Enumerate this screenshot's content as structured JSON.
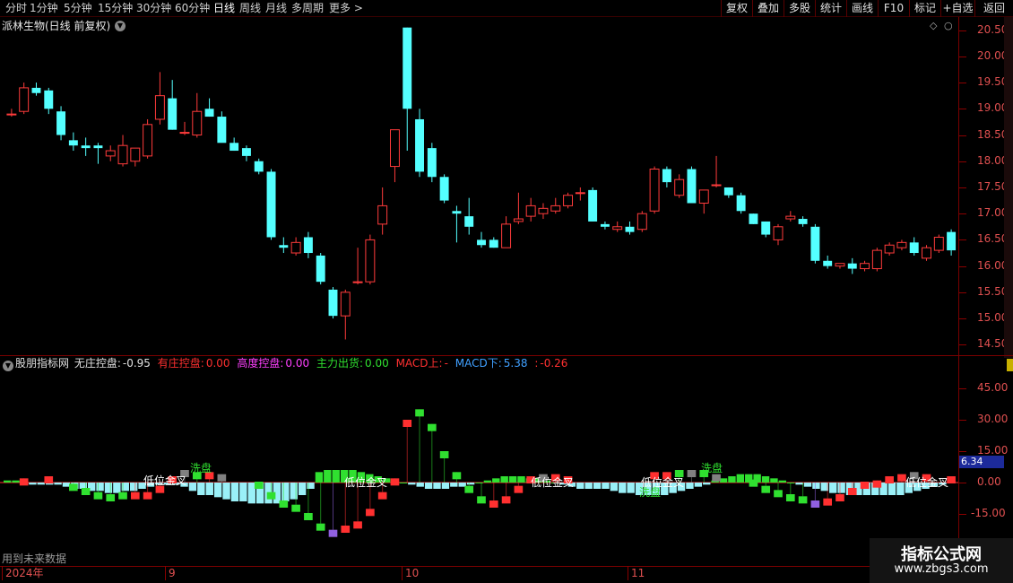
{
  "toolbar": {
    "periods": [
      "分时",
      "1分钟",
      "5分钟",
      "15分钟",
      "30分钟",
      "60分钟",
      "日线",
      "周线",
      "月线",
      "多周期",
      "更多"
    ],
    "more_arrow": ">",
    "active_period": "日线",
    "buttons": [
      "复权",
      "叠加",
      "多股",
      "统计",
      "画线",
      "F10",
      "标记",
      "+自选",
      "返回"
    ]
  },
  "main_chart": {
    "title": "派林生物(日线 前复权)",
    "y_ticks": [
      "20.50",
      "20.00",
      "19.50",
      "19.00",
      "18.50",
      "18.00",
      "17.50",
      "17.00",
      "16.50",
      "16.00",
      "15.50",
      "15.00",
      "14.50"
    ]
  },
  "indicator": {
    "name": "股朋指标网",
    "items": [
      {
        "label": "无庄控盘:",
        "value": "-0.95",
        "color": "#e0e0e0"
      },
      {
        "label": "有庄控盘:",
        "value": "0.00",
        "color": "#ff3030"
      },
      {
        "label": "高度控盘:",
        "value": "0.00",
        "color": "#ff40ff"
      },
      {
        "label": "主力出货:",
        "value": "0.00",
        "color": "#30e030"
      },
      {
        "label": "MACD上:",
        "value": "-",
        "color": "#ff3030"
      },
      {
        "label": "MACD下:",
        "value": "5.38",
        "color": "#40a0ff"
      },
      {
        "label": ":",
        "value": "-0.26",
        "color": "#ff3030"
      }
    ],
    "y_ticks": [
      "45.00",
      "30.00",
      "15.00",
      "0.00",
      "-15.00"
    ],
    "current_value": "6.34",
    "annotations": [
      "低位金叉",
      "洗盘",
      "低位金叉",
      "低位金叉",
      "低位金叉",
      "洗盘",
      "洗盘",
      "低位金叉"
    ],
    "future_note": "用到未来数据"
  },
  "dates": {
    "labels": [
      "2024年",
      "9",
      "10",
      "11"
    ]
  },
  "watermark": {
    "title": "指标公式网",
    "url": "www.zbgs3.com"
  },
  "chart_data": {
    "type": "candlestick",
    "ylim": [
      14.3,
      20.75
    ],
    "candles": [
      {
        "o": 18.9,
        "h": 19.0,
        "l": 18.85,
        "c": 18.9
      },
      {
        "o": 18.95,
        "h": 19.5,
        "l": 18.9,
        "c": 19.4
      },
      {
        "o": 19.4,
        "h": 19.5,
        "l": 19.25,
        "c": 19.3
      },
      {
        "o": 19.35,
        "h": 19.4,
        "l": 18.9,
        "c": 19.0
      },
      {
        "o": 18.95,
        "h": 19.05,
        "l": 18.4,
        "c": 18.5
      },
      {
        "o": 18.4,
        "h": 18.55,
        "l": 18.2,
        "c": 18.3
      },
      {
        "o": 18.3,
        "h": 18.45,
        "l": 18.1,
        "c": 18.25
      },
      {
        "o": 18.3,
        "h": 18.35,
        "l": 17.95,
        "c": 18.25
      },
      {
        "o": 18.1,
        "h": 18.3,
        "l": 18.0,
        "c": 18.2
      },
      {
        "o": 17.95,
        "h": 18.5,
        "l": 17.9,
        "c": 18.3
      },
      {
        "o": 18.0,
        "h": 18.25,
        "l": 17.9,
        "c": 18.25
      },
      {
        "o": 18.1,
        "h": 18.8,
        "l": 18.05,
        "c": 18.7
      },
      {
        "o": 18.8,
        "h": 19.7,
        "l": 18.7,
        "c": 19.25
      },
      {
        "o": 19.2,
        "h": 19.55,
        "l": 18.6,
        "c": 18.6
      },
      {
        "o": 18.55,
        "h": 18.75,
        "l": 18.5,
        "c": 18.55
      },
      {
        "o": 18.5,
        "h": 19.3,
        "l": 18.45,
        "c": 18.95
      },
      {
        "o": 19.0,
        "h": 19.2,
        "l": 18.85,
        "c": 18.85
      },
      {
        "o": 18.85,
        "h": 18.95,
        "l": 18.4,
        "c": 18.35
      },
      {
        "o": 18.35,
        "h": 18.45,
        "l": 18.2,
        "c": 18.2
      },
      {
        "o": 18.25,
        "h": 18.3,
        "l": 18.0,
        "c": 18.1
      },
      {
        "o": 18.0,
        "h": 18.05,
        "l": 17.75,
        "c": 17.8
      },
      {
        "o": 17.8,
        "h": 17.85,
        "l": 16.5,
        "c": 16.55
      },
      {
        "o": 16.4,
        "h": 16.55,
        "l": 16.25,
        "c": 16.35
      },
      {
        "o": 16.25,
        "h": 16.55,
        "l": 16.2,
        "c": 16.45
      },
      {
        "o": 16.55,
        "h": 16.65,
        "l": 16.15,
        "c": 16.25
      },
      {
        "o": 16.2,
        "h": 16.25,
        "l": 15.65,
        "c": 15.7
      },
      {
        "o": 15.55,
        "h": 15.6,
        "l": 15.0,
        "c": 15.05
      },
      {
        "o": 15.05,
        "h": 15.55,
        "l": 14.6,
        "c": 15.5
      },
      {
        "o": 15.7,
        "h": 16.35,
        "l": 15.65,
        "c": 15.7
      },
      {
        "o": 15.7,
        "h": 16.6,
        "l": 15.65,
        "c": 16.5
      },
      {
        "o": 16.8,
        "h": 17.5,
        "l": 16.6,
        "c": 17.15
      },
      {
        "o": 17.9,
        "h": 18.6,
        "l": 17.6,
        "c": 18.6
      },
      {
        "o": 20.55,
        "h": 20.55,
        "l": 18.2,
        "c": 19.0
      },
      {
        "o": 18.8,
        "h": 19.0,
        "l": 17.7,
        "c": 17.8
      },
      {
        "o": 18.25,
        "h": 18.35,
        "l": 17.6,
        "c": 17.7
      },
      {
        "o": 17.7,
        "h": 17.75,
        "l": 17.2,
        "c": 17.25
      },
      {
        "o": 17.05,
        "h": 17.15,
        "l": 16.45,
        "c": 17.0
      },
      {
        "o": 16.95,
        "h": 17.3,
        "l": 16.6,
        "c": 16.75
      },
      {
        "o": 16.5,
        "h": 16.65,
        "l": 16.35,
        "c": 16.4
      },
      {
        "o": 16.5,
        "h": 16.55,
        "l": 16.35,
        "c": 16.35
      },
      {
        "o": 16.35,
        "h": 16.95,
        "l": 16.35,
        "c": 16.8
      },
      {
        "o": 16.85,
        "h": 17.4,
        "l": 16.8,
        "c": 16.9
      },
      {
        "o": 16.95,
        "h": 17.3,
        "l": 16.85,
        "c": 17.15
      },
      {
        "o": 17.0,
        "h": 17.2,
        "l": 16.9,
        "c": 17.1
      },
      {
        "o": 17.05,
        "h": 17.3,
        "l": 17.0,
        "c": 17.15
      },
      {
        "o": 17.15,
        "h": 17.4,
        "l": 17.1,
        "c": 17.35
      },
      {
        "o": 17.4,
        "h": 17.5,
        "l": 17.25,
        "c": 17.4
      },
      {
        "o": 17.45,
        "h": 17.5,
        "l": 16.85,
        "c": 16.85
      },
      {
        "o": 16.8,
        "h": 16.85,
        "l": 16.7,
        "c": 16.75
      },
      {
        "o": 16.7,
        "h": 16.85,
        "l": 16.65,
        "c": 16.75
      },
      {
        "o": 16.75,
        "h": 16.85,
        "l": 16.6,
        "c": 16.65
      },
      {
        "o": 16.7,
        "h": 17.05,
        "l": 16.65,
        "c": 17.0
      },
      {
        "o": 17.05,
        "h": 17.9,
        "l": 17.0,
        "c": 17.85
      },
      {
        "o": 17.85,
        "h": 17.9,
        "l": 17.5,
        "c": 17.6
      },
      {
        "o": 17.35,
        "h": 17.75,
        "l": 17.3,
        "c": 17.65
      },
      {
        "o": 17.85,
        "h": 17.9,
        "l": 17.2,
        "c": 17.2
      },
      {
        "o": 17.2,
        "h": 17.45,
        "l": 17.0,
        "c": 17.45
      },
      {
        "o": 17.55,
        "h": 18.1,
        "l": 17.5,
        "c": 17.55
      },
      {
        "o": 17.5,
        "h": 17.5,
        "l": 17.3,
        "c": 17.35
      },
      {
        "o": 17.35,
        "h": 17.4,
        "l": 17.0,
        "c": 17.05
      },
      {
        "o": 17.0,
        "h": 17.0,
        "l": 16.8,
        "c": 16.8
      },
      {
        "o": 16.85,
        "h": 16.85,
        "l": 16.55,
        "c": 16.6
      },
      {
        "o": 16.5,
        "h": 16.8,
        "l": 16.4,
        "c": 16.75
      },
      {
        "o": 16.9,
        "h": 17.05,
        "l": 16.85,
        "c": 16.95
      },
      {
        "o": 16.9,
        "h": 16.95,
        "l": 16.75,
        "c": 16.8
      },
      {
        "o": 16.75,
        "h": 16.8,
        "l": 16.05,
        "c": 16.1
      },
      {
        "o": 16.1,
        "h": 16.2,
        "l": 15.95,
        "c": 16.0
      },
      {
        "o": 16.0,
        "h": 16.05,
        "l": 15.95,
        "c": 16.05
      },
      {
        "o": 16.05,
        "h": 16.15,
        "l": 15.85,
        "c": 15.95
      },
      {
        "o": 15.95,
        "h": 16.1,
        "l": 15.9,
        "c": 16.05
      },
      {
        "o": 15.95,
        "h": 16.35,
        "l": 15.9,
        "c": 16.3
      },
      {
        "o": 16.25,
        "h": 16.45,
        "l": 16.2,
        "c": 16.4
      },
      {
        "o": 16.35,
        "h": 16.5,
        "l": 16.3,
        "c": 16.45
      },
      {
        "o": 16.45,
        "h": 16.55,
        "l": 16.2,
        "c": 16.25
      },
      {
        "o": 16.15,
        "h": 16.4,
        "l": 16.1,
        "c": 16.35
      },
      {
        "o": 16.3,
        "h": 16.6,
        "l": 16.25,
        "c": 16.55
      },
      {
        "o": 16.65,
        "h": 16.7,
        "l": 16.2,
        "c": 16.3
      }
    ],
    "histogram": [
      1,
      1,
      0,
      -1,
      -1,
      -1,
      -1,
      -2,
      -3,
      -3,
      -4,
      -4,
      -5,
      -5,
      -4,
      -4,
      -3,
      -2,
      -1,
      -1,
      -1,
      -2,
      -4,
      -6,
      -6,
      -7,
      -8,
      -9,
      -9,
      -10,
      -10,
      -10,
      -10,
      -9,
      -8,
      -6,
      -3,
      5,
      6,
      6,
      6,
      6,
      5,
      4,
      3,
      2,
      1,
      0,
      -1,
      -2,
      -3,
      -3,
      -3,
      -2,
      -2,
      -1,
      0,
      1,
      2,
      3,
      3,
      3,
      2,
      2,
      1,
      0,
      -1,
      -2,
      -3,
      -3,
      -3,
      -3,
      -4,
      -5,
      -5,
      -6,
      -6,
      -6,
      -6,
      -5,
      -4,
      -3,
      -2,
      -1,
      1,
      2,
      3,
      4,
      4,
      4,
      3,
      2,
      1,
      0,
      -1,
      -2,
      -3,
      -4,
      -5,
      -5,
      -6,
      -6,
      -6,
      -6,
      -6,
      -6,
      -6,
      -5,
      -4,
      -3,
      -2,
      -1,
      1
    ],
    "markers": [
      {
        "i": 1,
        "v": 2,
        "c": "#ff3030"
      },
      {
        "i": 3,
        "v": 3,
        "c": "#ff3030"
      },
      {
        "i": 5,
        "v": -4,
        "c": "#30e030"
      },
      {
        "i": 6,
        "v": -6,
        "c": "#30e030"
      },
      {
        "i": 7,
        "v": -8,
        "c": "#30e030"
      },
      {
        "i": 8,
        "v": -9,
        "c": "#30e030"
      },
      {
        "i": 9,
        "v": -8,
        "c": "#30e030"
      },
      {
        "i": 10,
        "v": -8,
        "c": "#ff3030"
      },
      {
        "i": 11,
        "v": -8,
        "c": "#ff3030"
      },
      {
        "i": 12,
        "v": -5,
        "c": "#ff3030"
      },
      {
        "i": 13,
        "v": 3,
        "c": "#ff3030"
      },
      {
        "i": 14,
        "v": 6,
        "c": "#808080"
      },
      {
        "i": 15,
        "v": 5,
        "c": "#30e030"
      },
      {
        "i": 16,
        "v": 5,
        "c": "#ff3030"
      },
      {
        "i": 17,
        "v": 4,
        "c": "#808080"
      },
      {
        "i": 20,
        "v": -3,
        "c": "#30e030"
      },
      {
        "i": 21,
        "v": -8,
        "c": "#30e030"
      },
      {
        "i": 22,
        "v": -12,
        "c": "#30e030"
      },
      {
        "i": 23,
        "v": -14,
        "c": "#30e030"
      },
      {
        "i": 24,
        "v": -18,
        "c": "#30e030"
      },
      {
        "i": 25,
        "v": -23,
        "c": "#30e030"
      },
      {
        "i": 26,
        "v": -26,
        "c": "#9060e0"
      },
      {
        "i": 27,
        "v": -24,
        "c": "#ff3030"
      },
      {
        "i": 28,
        "v": -22,
        "c": "#ff3030"
      },
      {
        "i": 29,
        "v": -16,
        "c": "#ff3030"
      },
      {
        "i": 30,
        "v": -8,
        "c": "#ff3030"
      },
      {
        "i": 31,
        "v": 2,
        "c": "#ff3030"
      },
      {
        "i": 32,
        "v": 30,
        "c": "#ff3030"
      },
      {
        "i": 33,
        "v": 35,
        "c": "#30e030"
      },
      {
        "i": 34,
        "v": 28,
        "c": "#30e030"
      },
      {
        "i": 35,
        "v": 15,
        "c": "#30e030"
      },
      {
        "i": 36,
        "v": 5,
        "c": "#30e030"
      },
      {
        "i": 37,
        "v": -5,
        "c": "#30e030"
      },
      {
        "i": 38,
        "v": -10,
        "c": "#30e030"
      },
      {
        "i": 39,
        "v": -12,
        "c": "#ff3030"
      },
      {
        "i": 40,
        "v": -10,
        "c": "#ff3030"
      },
      {
        "i": 41,
        "v": -5,
        "c": "#ff3030"
      },
      {
        "i": 42,
        "v": 3,
        "c": "#ff3030"
      },
      {
        "i": 43,
        "v": 4,
        "c": "#808080"
      },
      {
        "i": 44,
        "v": 4,
        "c": "#ff3030"
      },
      {
        "i": 45,
        "v": 3,
        "c": "#ff3030"
      },
      {
        "i": 52,
        "v": 5,
        "c": "#ff3030"
      },
      {
        "i": 53,
        "v": 5,
        "c": "#ff3030"
      },
      {
        "i": 54,
        "v": 6,
        "c": "#30e030"
      },
      {
        "i": 55,
        "v": 6,
        "c": "#808080"
      },
      {
        "i": 56,
        "v": 6,
        "c": "#30e030"
      },
      {
        "i": 57,
        "v": 4,
        "c": "#808080"
      },
      {
        "i": 60,
        "v": -2,
        "c": "#30e030"
      },
      {
        "i": 61,
        "v": -5,
        "c": "#30e030"
      },
      {
        "i": 62,
        "v": -7,
        "c": "#30e030"
      },
      {
        "i": 63,
        "v": -9,
        "c": "#30e030"
      },
      {
        "i": 64,
        "v": -10,
        "c": "#30e030"
      },
      {
        "i": 65,
        "v": -12,
        "c": "#9060e0"
      },
      {
        "i": 66,
        "v": -11,
        "c": "#ff3030"
      },
      {
        "i": 67,
        "v": -9,
        "c": "#ff3030"
      },
      {
        "i": 68,
        "v": -6,
        "c": "#ff3030"
      },
      {
        "i": 69,
        "v": -3,
        "c": "#ff3030"
      },
      {
        "i": 70,
        "v": 1,
        "c": "#ff3030"
      },
      {
        "i": 71,
        "v": 3,
        "c": "#ff3030"
      },
      {
        "i": 72,
        "v": 4,
        "c": "#ff3030"
      },
      {
        "i": 73,
        "v": 5,
        "c": "#808080"
      },
      {
        "i": 74,
        "v": 4,
        "c": "#ff3030"
      },
      {
        "i": 76,
        "v": 3,
        "c": "#ff3030"
      }
    ]
  }
}
